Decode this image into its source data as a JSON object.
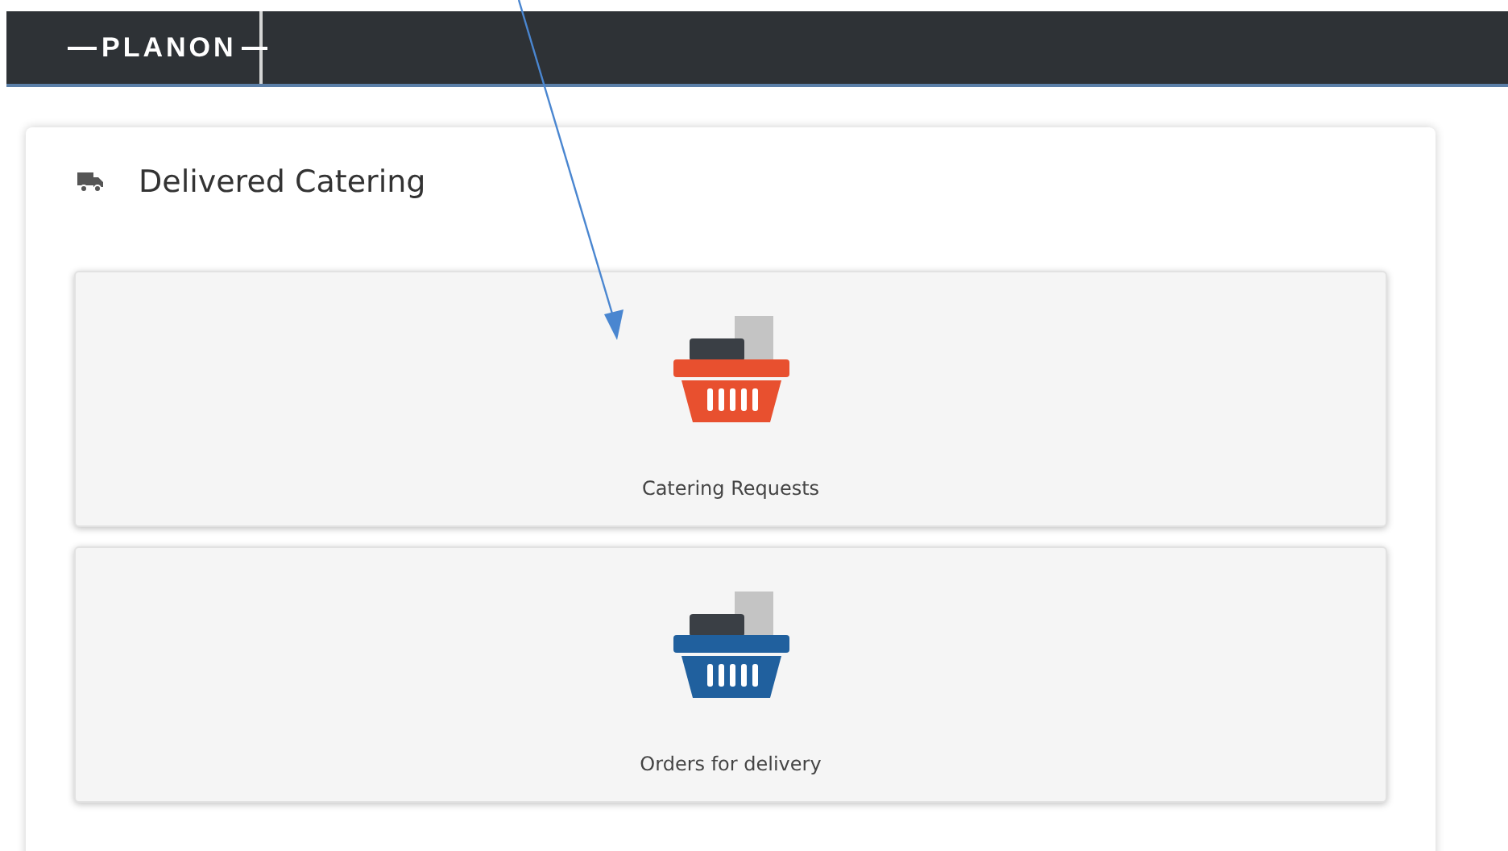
{
  "header": {
    "logo": "PLANON"
  },
  "panel": {
    "title": "Delivered Catering"
  },
  "tiles": [
    {
      "label": "Catering Requests",
      "color": "#e8502f"
    },
    {
      "label": "Orders for delivery",
      "color": "#20609e"
    }
  ],
  "annotation": {
    "kind": "arrow"
  }
}
